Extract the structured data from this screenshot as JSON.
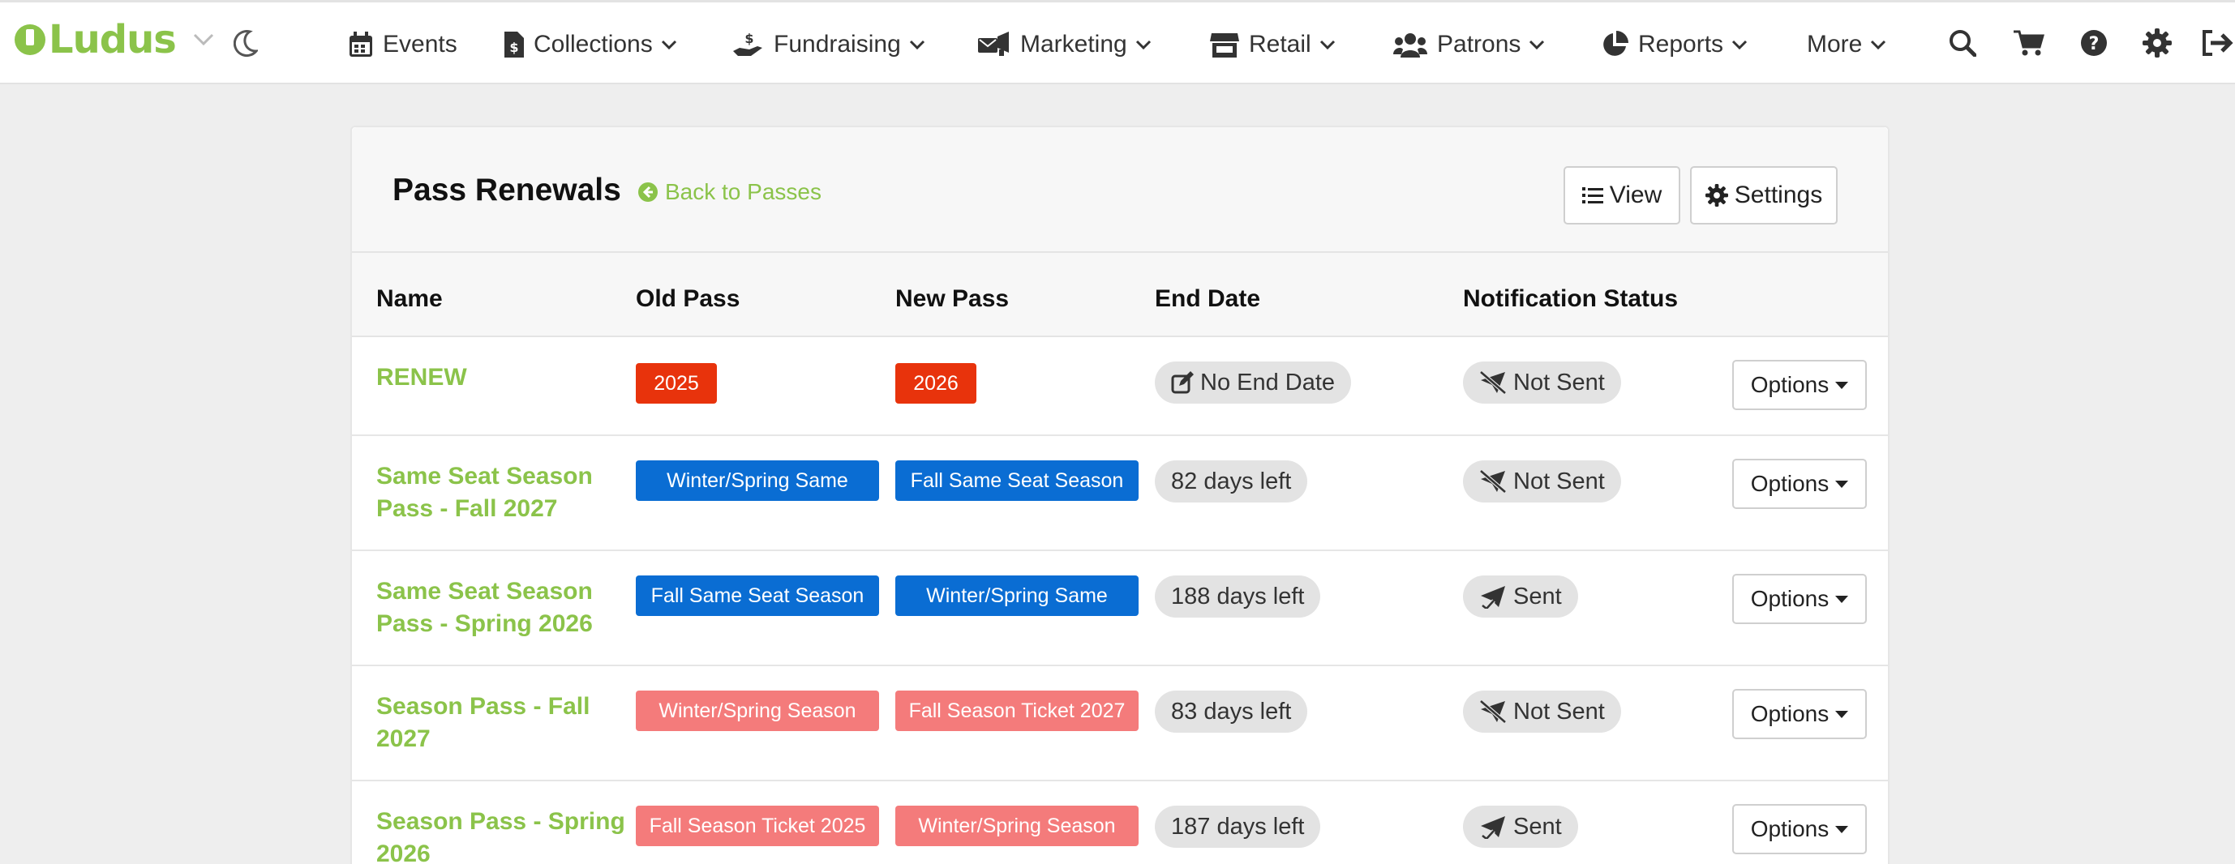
{
  "app": {
    "logo_text": "Ludus"
  },
  "nav": [
    {
      "label": "Events",
      "icon": "calendar-icon"
    },
    {
      "label": "Collections",
      "icon": "file-dollar-icon"
    },
    {
      "label": "Fundraising",
      "icon": "hand-dollar-icon"
    },
    {
      "label": "Marketing",
      "icon": "mail-bullhorn-icon"
    },
    {
      "label": "Retail",
      "icon": "store-icon"
    },
    {
      "label": "Patrons",
      "icon": "users-icon"
    },
    {
      "label": "Reports",
      "icon": "pie-chart-icon"
    },
    {
      "label": "More",
      "icon": ""
    }
  ],
  "header": {
    "title": "Pass Renewals",
    "back_label": "Back to Passes",
    "view_label": "View",
    "settings_label": "Settings"
  },
  "table": {
    "columns": [
      "Name",
      "Old Pass",
      "New Pass",
      "End Date",
      "Notification Status"
    ],
    "options_label": "Options",
    "rows": [
      {
        "name": "RENEW",
        "old_pass": "2025",
        "new_pass": "2026",
        "end_date": "No End Date",
        "status": "Not Sent"
      },
      {
        "name": "Same Seat Season Pass - Fall 2027",
        "old_pass": "Winter/Spring Same",
        "new_pass": "Fall Same Seat Season",
        "end_date": "82 days left",
        "status": "Not Sent"
      },
      {
        "name": "Same Seat Season Pass - Spring 2026",
        "old_pass": "Fall Same Seat Season",
        "new_pass": "Winter/Spring Same",
        "end_date": "188 days left",
        "status": "Sent"
      },
      {
        "name": "Season Pass - Fall 2027",
        "old_pass": "Winter/Spring Season",
        "new_pass": "Fall Season Ticket 2027",
        "end_date": "83 days left",
        "status": "Not Sent"
      },
      {
        "name": "Season Pass - Spring 2026",
        "old_pass": "Fall Season Ticket 2025",
        "new_pass": "Winter/Spring Season",
        "end_date": "187 days left",
        "status": "Sent"
      }
    ]
  },
  "colors": {
    "brand": "#8bc34a",
    "badge_red": "#e8330c",
    "badge_blue": "#0a6dd3",
    "badge_salmon": "#f47b7b"
  }
}
